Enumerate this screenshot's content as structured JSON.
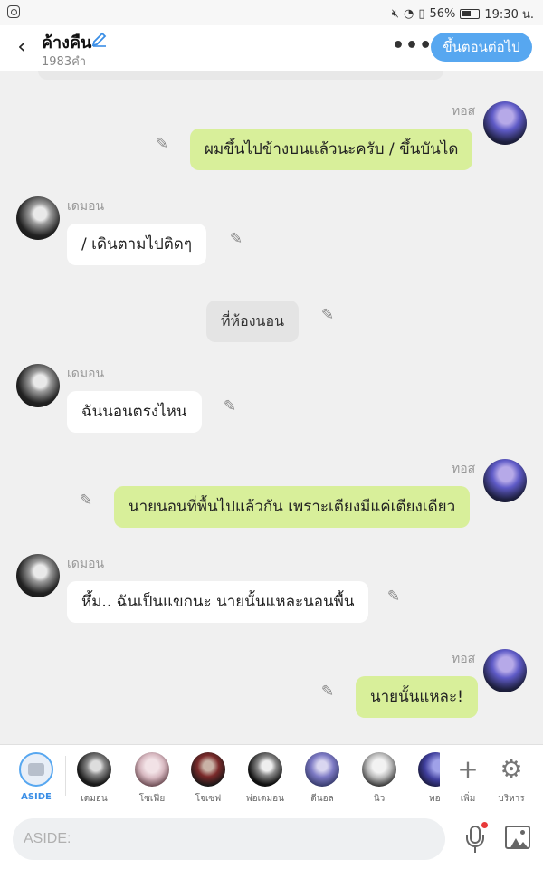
{
  "status_bar": {
    "battery": "56%",
    "time": "19:30 น."
  },
  "header": {
    "title": "ค้างคืน",
    "subtitle": "1983คำ",
    "next_label": "ขึ้นตอนต่อไป",
    "more_glyph": "•••"
  },
  "messages": [
    {
      "side": "right",
      "speaker": "ทอส",
      "text": "ผมขึ้นไปข้างบนแล้วนะครับ / ขึ้นบันได"
    },
    {
      "side": "left",
      "speaker": "เดมอน",
      "text": "/ เดินตามไปติดๆ"
    },
    {
      "side": "narration",
      "speaker": "",
      "text": "ที่ห้องนอน"
    },
    {
      "side": "left",
      "speaker": "เดมอน",
      "text": "ฉันนอนตรงไหน"
    },
    {
      "side": "right",
      "speaker": "ทอส",
      "text": "นายนอนที่พื้นไปแล้วกัน เพราะเตียงมีแค่เตียงเดียว"
    },
    {
      "side": "left",
      "speaker": "เดมอน",
      "text": "หึ้ม.. ฉันเป็นแขกนะ นายนั้นแหละนอนพื้น"
    },
    {
      "side": "right",
      "speaker": "ทอส",
      "text": "นายนั้นแหละ!"
    }
  ],
  "characters": [
    {
      "label": "ASIDE"
    },
    {
      "label": "เดมอน"
    },
    {
      "label": "โซเฟีย"
    },
    {
      "label": "โจเซฟ"
    },
    {
      "label": "พ่อเดมอน"
    },
    {
      "label": "ดีนอล"
    },
    {
      "label": "นิว"
    },
    {
      "label": "ทอ"
    }
  ],
  "tools": {
    "add_label": "เพิ่ม",
    "manage_label": "บริหาร"
  },
  "input": {
    "placeholder": "ASIDE:"
  },
  "colors": {
    "accent": "#57a7f0",
    "right_bubble": "#d8ef9a",
    "left_bubble": "#ffffff",
    "narration_bubble": "#e4e4e4",
    "background": "#f0f0f0"
  }
}
